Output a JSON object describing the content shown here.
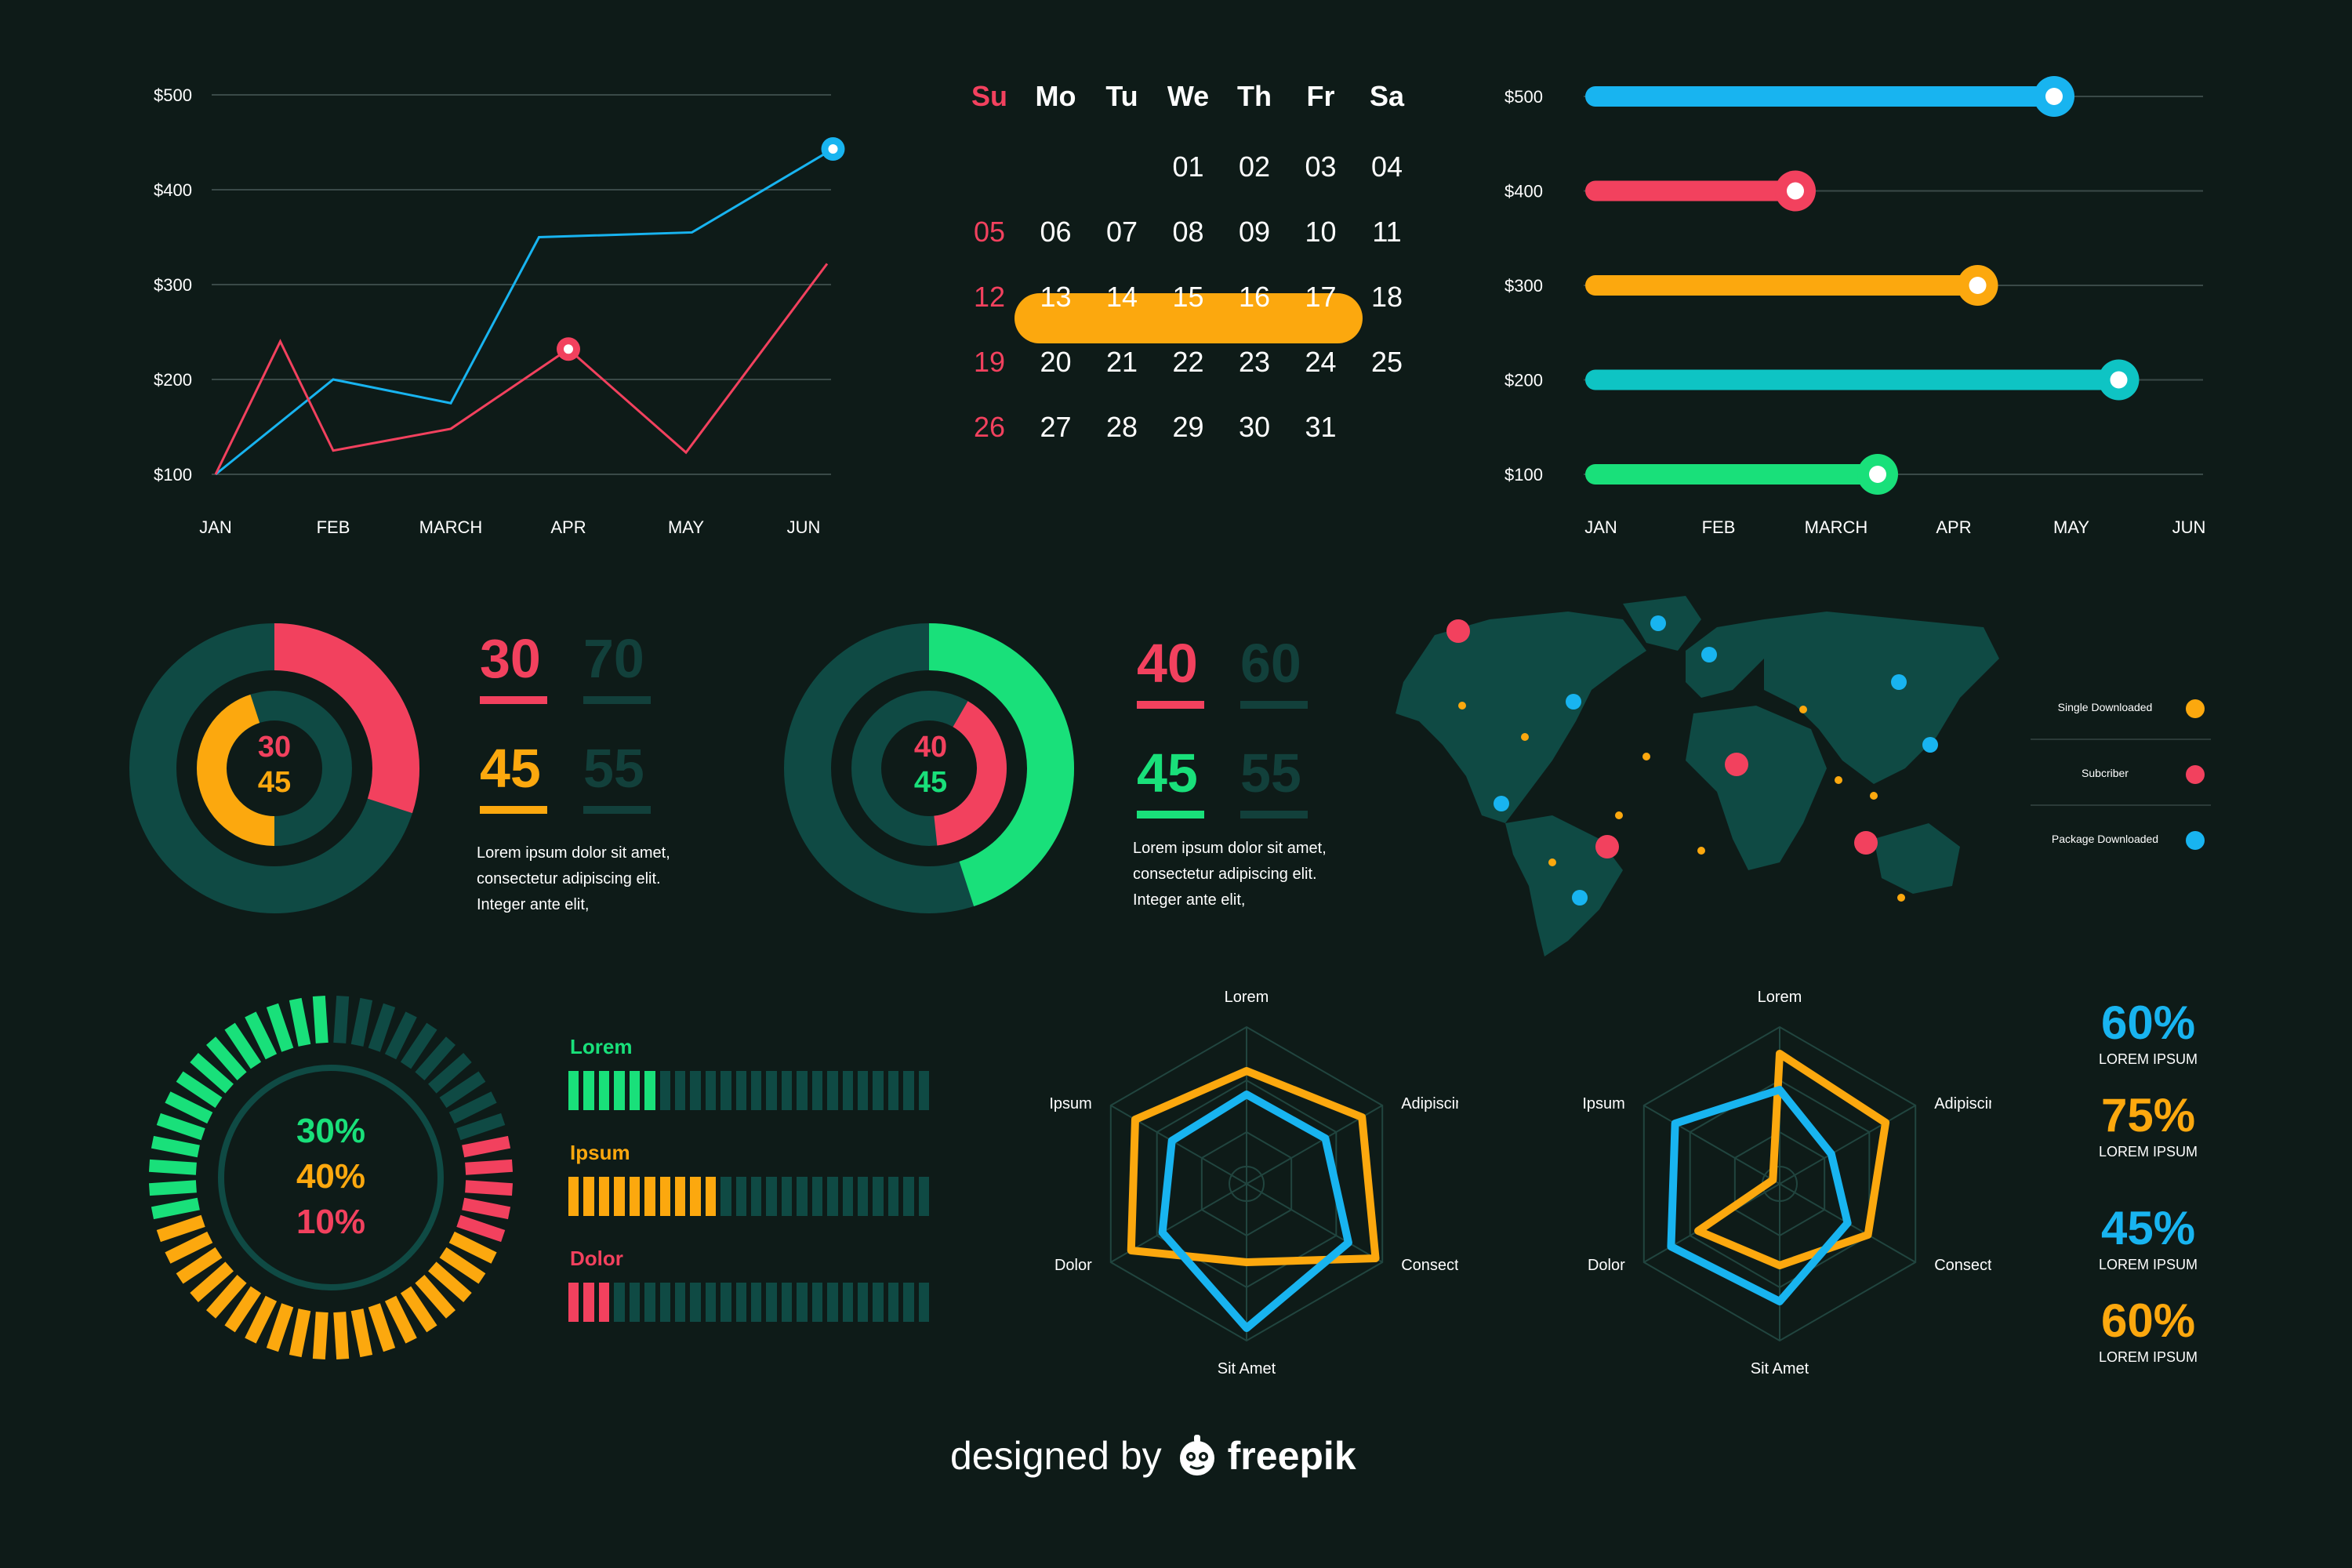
{
  "colors": {
    "bg": "#0e1b18",
    "panel": "#0f4a44",
    "dim": "#12403b",
    "grid": "#3a4a48",
    "red": "#f2415e",
    "blue": "#18b4f0",
    "orange": "#fca80e",
    "green": "#19e07a",
    "teal": "#0ec4c4"
  },
  "chart_data": [
    {
      "type": "line",
      "x": [
        "JAN",
        "FEB",
        "MARCH",
        "APR",
        "MAY",
        "JUN"
      ],
      "ylim": [
        100,
        500
      ],
      "y_ticks": [
        "$100",
        "$200",
        "$300",
        "$400",
        "$500"
      ],
      "series": [
        {
          "color": "#18b4f0",
          "points": [
            [
              0.0,
              100
            ],
            [
              1.0,
              200
            ],
            [
              2.0,
              175
            ],
            [
              2.75,
              350
            ],
            [
              4.05,
              355
            ],
            [
              5.25,
              443
            ]
          ]
        },
        {
          "color": "#f2415e",
          "points": [
            [
              0.0,
              100
            ],
            [
              0.55,
              240
            ],
            [
              1.0,
              125
            ],
            [
              2.0,
              148
            ],
            [
              3.0,
              232
            ],
            [
              4.0,
              123
            ],
            [
              5.2,
              322
            ]
          ]
        }
      ],
      "markers": [
        {
          "x": 5.25,
          "y": 443,
          "color": "#18b4f0"
        },
        {
          "x": 3.0,
          "y": 232,
          "color": "#f2415e"
        }
      ]
    },
    {
      "type": "bar",
      "orientation": "horizontal",
      "x_ticks": [
        "JAN",
        "FEB",
        "MARCH",
        "APR",
        "MAY",
        "JUN"
      ],
      "y_ticks": [
        "$500",
        "$400",
        "$300",
        "$200",
        "$100"
      ],
      "bars": [
        {
          "category": "$500",
          "value": 3.9,
          "color": "#18b4f0"
        },
        {
          "category": "$400",
          "value": 1.7,
          "color": "#f2415e"
        },
        {
          "category": "$300",
          "value": 3.25,
          "color": "#fca80e"
        },
        {
          "category": "$200",
          "value": 4.45,
          "color": "#0ec4c4"
        },
        {
          "category": "$100",
          "value": 2.4,
          "color": "#19e07a"
        }
      ]
    },
    {
      "type": "pie",
      "variant": "donut",
      "center_labels": [
        "30",
        "45"
      ],
      "outer": {
        "value": 30,
        "start": 0,
        "color": "#f2415e"
      },
      "inner": {
        "value": 45,
        "start": 50,
        "color": "#fca80e"
      }
    },
    {
      "type": "pie",
      "variant": "donut",
      "center_labels": [
        "40",
        "45"
      ],
      "outer": {
        "value": 45,
        "start": 0,
        "color": "#19e07a"
      },
      "inner": {
        "value": 40,
        "start": 0,
        "color": "#f2415e"
      }
    },
    {
      "type": "pie",
      "variant": "segmented-ring",
      "center_labels": [
        "30%",
        "40%",
        "10%"
      ],
      "segments": [
        {
          "value": 30,
          "color": "#19e07a"
        },
        {
          "value": 40,
          "color": "#fca80e"
        },
        {
          "value": 10,
          "color": "#f2415e"
        }
      ]
    },
    {
      "type": "bar",
      "orientation": "horizontal",
      "variant": "segmented",
      "categories": [
        "Lorem",
        "Ipsum",
        "Dolor"
      ],
      "values": [
        30,
        48,
        14
      ],
      "colors": [
        "#19e07a",
        "#fca80e",
        "#f2415e"
      ]
    },
    {
      "type": "radar",
      "axes": [
        "Lorem",
        "Adipiscing",
        "Consectetur",
        "Sit Amet",
        "Dolor",
        "Ipsum"
      ],
      "series": [
        {
          "color": "#fca80e",
          "values": [
            0.72,
            0.85,
            0.95,
            0.5,
            0.85,
            0.82
          ]
        },
        {
          "color": "#18b4f0",
          "values": [
            0.57,
            0.58,
            0.75,
            0.92,
            0.62,
            0.55
          ]
        }
      ]
    },
    {
      "type": "radar",
      "axes": [
        "Lorem",
        "Adipiscing",
        "Consectetur",
        "Sit Amet",
        "Dolor",
        "Ipsum"
      ],
      "series": [
        {
          "color": "#fca80e",
          "values": [
            0.83,
            0.78,
            0.65,
            0.52,
            0.6,
            0.05
          ]
        },
        {
          "color": "#18b4f0",
          "values": [
            0.6,
            0.38,
            0.5,
            0.75,
            0.8,
            0.77
          ]
        }
      ]
    }
  ],
  "calendar": {
    "headers": [
      "Su",
      "Mo",
      "Tu",
      "We",
      "Th",
      "Fr",
      "Sa"
    ],
    "weeks": [
      [
        "",
        "",
        "",
        "01",
        "02",
        "03",
        "04"
      ],
      [
        "05",
        "06",
        "07",
        "08",
        "09",
        "10",
        "11"
      ],
      [
        "12",
        "13",
        "14",
        "15",
        "16",
        "17",
        "18"
      ],
      [
        "19",
        "20",
        "21",
        "22",
        "23",
        "24",
        "25"
      ],
      [
        "26",
        "27",
        "28",
        "29",
        "30",
        "31",
        ""
      ]
    ],
    "highlight_range": [
      "13",
      "17"
    ]
  },
  "donut1": {
    "center_top": "30",
    "center_bottom": "45",
    "stats": [
      {
        "value": "30",
        "color": "#f2415e"
      },
      {
        "value": "70",
        "color": "#12403b"
      },
      {
        "value": "45",
        "color": "#fca80e"
      },
      {
        "value": "55",
        "color": "#12403b"
      }
    ],
    "text": [
      "Lorem ipsum dolor sit amet,",
      "consectetur adipiscing elit.",
      "Integer ante elit,"
    ]
  },
  "donut2": {
    "center_top": "40",
    "center_bottom": "45",
    "stats": [
      {
        "value": "40",
        "color": "#f2415e"
      },
      {
        "value": "60",
        "color": "#12403b"
      },
      {
        "value": "45",
        "color": "#19e07a"
      },
      {
        "value": "55",
        "color": "#12403b"
      }
    ],
    "text": [
      "Lorem ipsum dolor sit amet,",
      "consectetur adipiscing elit.",
      "Integer ante elit,"
    ]
  },
  "ring": {
    "labels": [
      "30%",
      "40%",
      "10%"
    ]
  },
  "hbars": [
    {
      "label": "Lorem",
      "filled": 6,
      "color": "#19e07a"
    },
    {
      "label": "Ipsum",
      "filled": 10,
      "color": "#fca80e"
    },
    {
      "label": "Dolor",
      "filled": 3,
      "color": "#f2415e"
    }
  ],
  "map": {
    "legend": [
      {
        "label": "Single Downloaded",
        "color": "#fca80e"
      },
      {
        "label": "Subcriber",
        "color": "#f2415e"
      },
      {
        "label": "Package Downloaded",
        "color": "#18b4f0"
      }
    ]
  },
  "stats": [
    {
      "value": "60%",
      "caption": "LOREM IPSUM",
      "color": "#18b4f0"
    },
    {
      "value": "75%",
      "caption": "LOREM IPSUM",
      "color": "#fca80e"
    },
    {
      "value": "45%",
      "caption": "LOREM IPSUM",
      "color": "#18b4f0"
    },
    {
      "value": "60%",
      "caption": "LOREM IPSUM",
      "color": "#fca80e"
    }
  ],
  "credit": {
    "prefix": "designed by",
    "brand": "freepik"
  }
}
